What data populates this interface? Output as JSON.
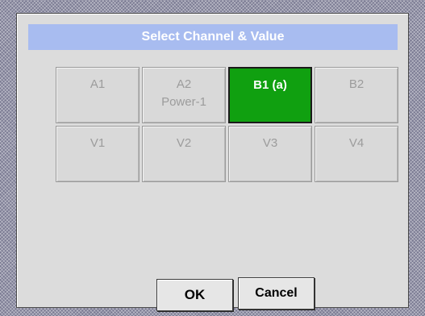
{
  "dialog": {
    "title": "Select Channel & Value"
  },
  "channels": [
    {
      "line1": "A1",
      "line2": "",
      "selected": false
    },
    {
      "line1": "A2",
      "line2": "Power-1",
      "selected": false
    },
    {
      "line1": "B1 (a)",
      "line2": "",
      "selected": true
    },
    {
      "line1": "B2",
      "line2": "",
      "selected": false
    },
    {
      "line1": "V1",
      "line2": "",
      "selected": false
    },
    {
      "line1": "V2",
      "line2": "",
      "selected": false
    },
    {
      "line1": "V3",
      "line2": "",
      "selected": false
    },
    {
      "line1": "V4",
      "line2": "",
      "selected": false
    }
  ],
  "buttons": {
    "ok_label": "OK",
    "cancel_label": "Cancel"
  },
  "colors": {
    "title_bar": "#a8bcf0",
    "selected": "#10a010",
    "button_face": "#d9d9d9",
    "disabled_text": "#9c9c9c"
  }
}
